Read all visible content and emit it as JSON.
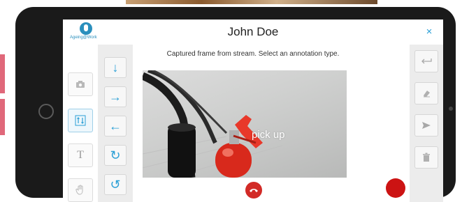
{
  "app": {
    "logo_text": "Ageing@Work",
    "title": "John Doe",
    "close_label": "×"
  },
  "instruction": "Captured frame from stream. Select an annotation type.",
  "frame": {
    "annotation_label": "pick up"
  },
  "left_tools": [
    {
      "icon": "camera-icon",
      "active": false
    },
    {
      "icon": "arrows-icon",
      "active": true
    },
    {
      "icon": "text-icon",
      "label": "T",
      "active": false
    },
    {
      "icon": "hand-icon",
      "active": false
    }
  ],
  "arrow_tools": [
    {
      "icon": "arrow-down-icon",
      "glyph": "↓"
    },
    {
      "icon": "arrow-right-icon",
      "glyph": "→"
    },
    {
      "icon": "arrow-left-icon",
      "glyph": "←"
    },
    {
      "icon": "rotate-clockwise-icon",
      "glyph": "↻"
    },
    {
      "icon": "rotate-counterclockwise-icon",
      "glyph": "↺"
    }
  ],
  "right_tools": [
    {
      "icon": "return-icon"
    },
    {
      "icon": "eraser-icon"
    },
    {
      "icon": "send-icon"
    },
    {
      "icon": "trash-icon"
    }
  ],
  "colors": {
    "accent": "#2a9fd6",
    "hangup": "#d22a26",
    "record": "#cc1313",
    "annotation": "#e8382a"
  }
}
